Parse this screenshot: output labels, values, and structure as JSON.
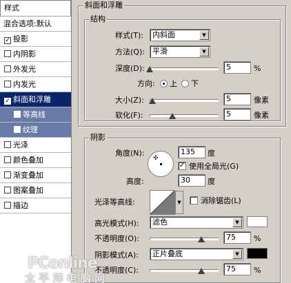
{
  "left": {
    "header": "样式",
    "items": [
      {
        "label": "混合选项:默认",
        "check": false,
        "plain": true
      },
      {
        "label": "投影",
        "check": true
      },
      {
        "label": "内阴影",
        "check": false
      },
      {
        "label": "外发光",
        "check": false
      },
      {
        "label": "内发光",
        "check": false
      },
      {
        "label": "斜面和浮雕",
        "check": true,
        "selected": true
      },
      {
        "label": "等高线",
        "check": false,
        "sub": true
      },
      {
        "label": "纹理",
        "check": false,
        "sub": true
      },
      {
        "label": "光泽",
        "check": false
      },
      {
        "label": "颜色叠加",
        "check": false
      },
      {
        "label": "渐变叠加",
        "check": false
      },
      {
        "label": "图案叠加",
        "check": false
      },
      {
        "label": "描边",
        "check": false
      }
    ],
    "check_mark": "✓"
  },
  "bevel": {
    "title": "斜面和浮雕",
    "structure_title": "结构",
    "style_label": "样式(T):",
    "style_value": "内斜面",
    "technique_label": "方法(Q):",
    "technique_value": "平滑",
    "depth_label": "深度(D):",
    "depth_value": "5",
    "depth_unit": "%",
    "depth_fraction": 0.0,
    "direction_label": "方向:",
    "dir_up": "上",
    "dir_down": "下",
    "size_label": "大小(Z):",
    "size_value": "5",
    "size_unit": "像素",
    "size_fraction": 0.04,
    "soften_label": "软化(F):",
    "soften_value": "5",
    "soften_unit": "像素",
    "soften_fraction": 0.33
  },
  "shading": {
    "title": "阴影",
    "angle_label": "角度(N):",
    "angle_value": "135",
    "angle_unit": "度",
    "global_light_label": "使用全局光(G)",
    "global_light": true,
    "altitude_label": "高度:",
    "altitude_value": "30",
    "altitude_unit": "度",
    "gloss_contour_label": "光泽等高线:",
    "anti_alias_label": "消除锯齿(L)",
    "anti_alias": false,
    "highlight_mode_label": "高光模式(H):",
    "highlight_mode_value": "滤色",
    "highlight_color": "#ffffff",
    "highlight_opacity_label": "不透明度(O):",
    "highlight_opacity_value": "75",
    "highlight_opacity_unit": "%",
    "highlight_opacity_fraction": 0.75,
    "shadow_mode_label": "阴影模式(A):",
    "shadow_mode_value": "正片叠底",
    "shadow_color": "#000000",
    "shadow_opacity_label": "不透明度(C):",
    "shadow_opacity_value": "75",
    "shadow_opacity_unit": "%",
    "shadow_opacity_fraction": 0.75
  },
  "watermark": {
    "line1": "PConline",
    "line2": "太 平 洋 电 脑 网"
  },
  "icons": {
    "dropdown": "▼",
    "contour_arrow": "▼",
    "crosshair": "✣"
  }
}
